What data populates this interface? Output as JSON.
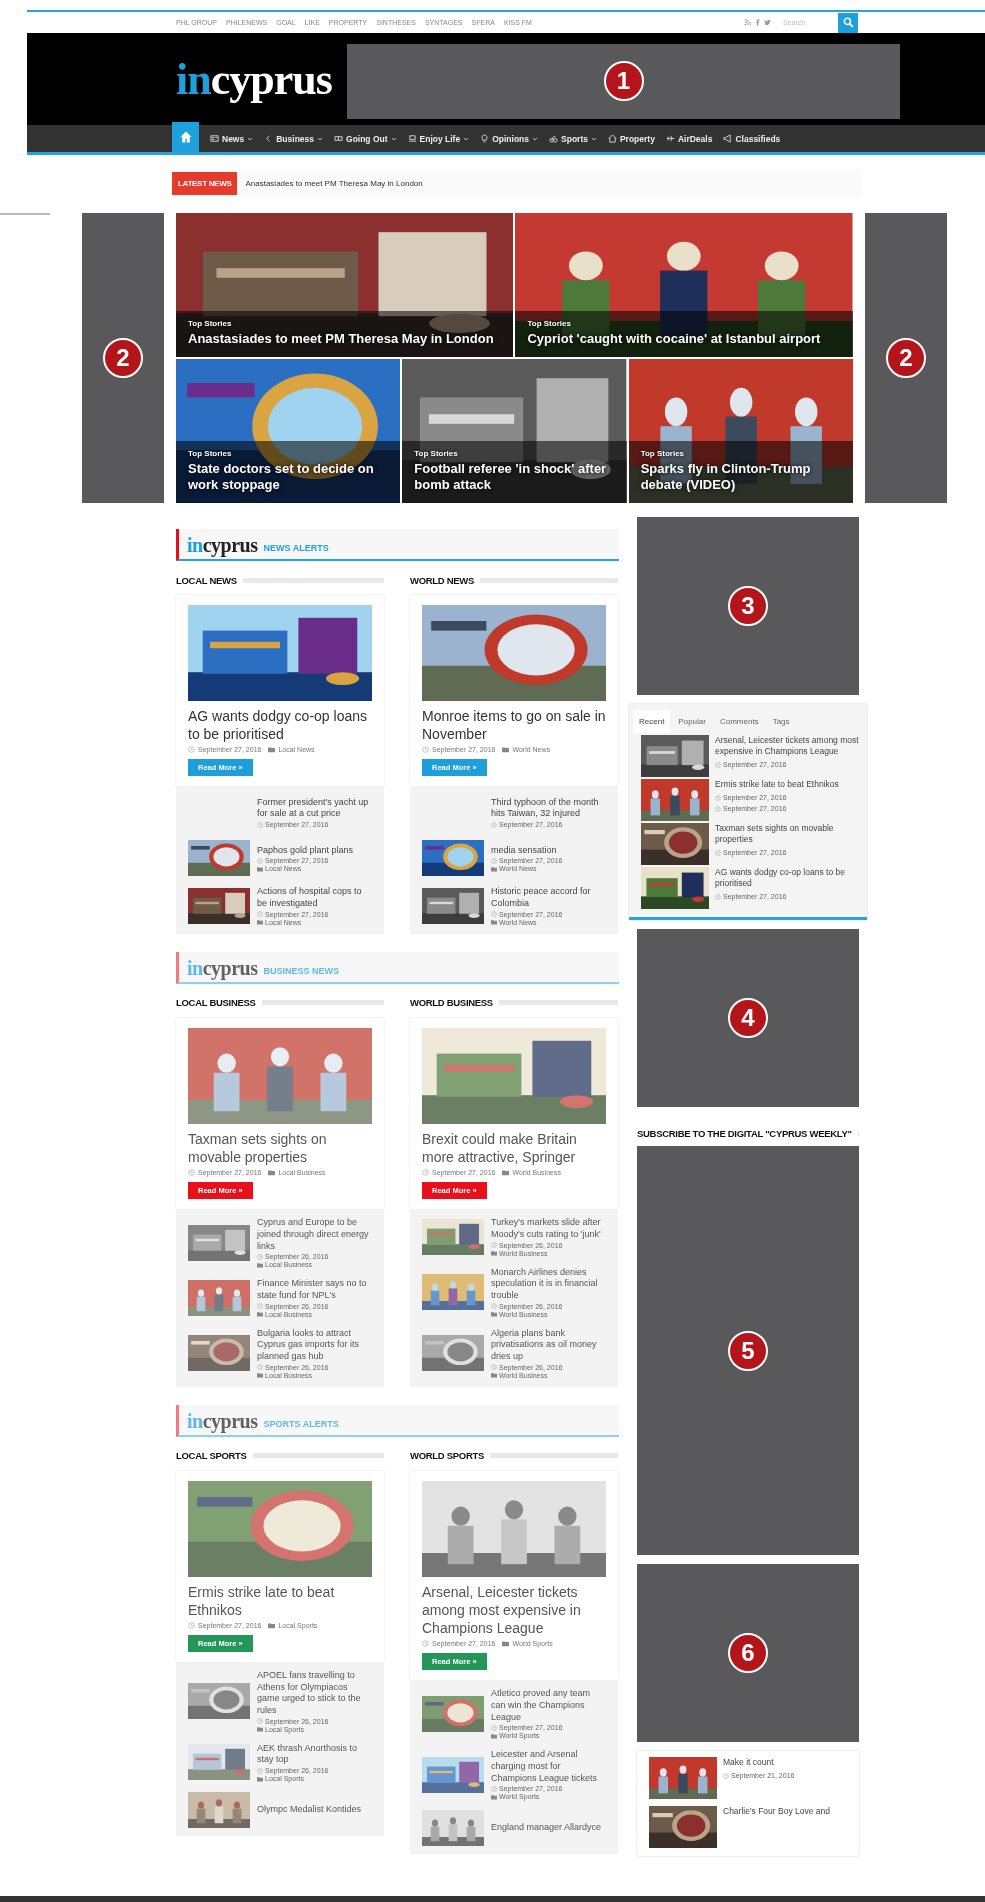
{
  "top_bar": {
    "links": [
      "PHL GROUP",
      "PHILENEWS",
      "GOAL",
      "LIKE",
      "PROPERTY",
      "SINTHESES",
      "SYNTAGES",
      "SFERA",
      "KISS FM"
    ],
    "search": {
      "placeholder": "Search"
    }
  },
  "header": {
    "logo": {
      "accent": "in",
      "rest": "cyprus"
    },
    "ad": {
      "number": "1"
    }
  },
  "nav": {
    "items": [
      {
        "kind": "home",
        "selected": true
      },
      {
        "kind": "menu",
        "label": "News",
        "dropdown": true,
        "selected": false
      },
      {
        "kind": "menu",
        "label": "Business",
        "dropdown": true,
        "selected": false
      },
      {
        "kind": "menu",
        "label": "Going Out",
        "dropdown": true,
        "selected": false
      },
      {
        "kind": "menu",
        "label": "Enjoy Life",
        "dropdown": true,
        "selected": false
      },
      {
        "kind": "menu",
        "label": "Opinions",
        "dropdown": true,
        "selected": false
      },
      {
        "kind": "menu",
        "label": "Sports",
        "dropdown": true,
        "selected": false
      },
      {
        "kind": "menu",
        "label": "Property",
        "dropdown": false,
        "selected": false
      },
      {
        "kind": "menu",
        "label": "AirDeals",
        "dropdown": false,
        "selected": false
      },
      {
        "kind": "menu",
        "label": "Classifieds",
        "dropdown": false,
        "selected": false
      }
    ]
  },
  "latest_news": {
    "label": "LATEST NEWS",
    "headline": "Anastasiades to meet PM Theresa May in London"
  },
  "side_ads": [
    {
      "number": "2"
    },
    {
      "number": "2"
    }
  ],
  "hero": {
    "tiles": [
      {
        "category": "Top Stories",
        "title": "Anastasiades to meet PM Theresa May in London"
      },
      {
        "category": "Top Stories",
        "title": "Cypriot 'caught with cocaine' at Istanbul airport"
      },
      {
        "category": "Top Stories",
        "title": "State doctors set to decide on work stoppage"
      },
      {
        "category": "Top Stories",
        "title": "Football referee 'in shock' after bomb attack"
      },
      {
        "category": "Top Stories",
        "title": "Sparks fly in Clinton-Trump debate (VIDEO)"
      }
    ]
  },
  "sections": [
    {
      "brand": {
        "accent": "in",
        "rest": "cyprus"
      },
      "label": "NEWS ALERTS",
      "dimmed": false,
      "color": "#1e9fdc",
      "columns": [
        {
          "title": "LOCAL NEWS",
          "featured": {
            "title": "AG wants dodgy co-op loans to be prioritised",
            "date": "September 27, 2016",
            "category": "Local News",
            "button": "Read More »"
          },
          "items": [
            {
              "title": "Former president's yacht up for sale at a cut price",
              "date": "September 27, 2016",
              "image": false
            },
            {
              "title": "Paphos gold plant plans",
              "date": "September 27, 2016",
              "category": "Local News",
              "image": true
            },
            {
              "title": "Actions of hospital cops to be investigated",
              "date": "September 27, 2016",
              "category": "Local News",
              "image": true
            }
          ]
        },
        {
          "title": "WORLD NEWS",
          "featured": {
            "title": "Monroe items to go on sale in November",
            "date": "September 27, 2016",
            "category": "World News",
            "button": "Read More »"
          },
          "items": [
            {
              "title": "Third typhoon of the month hits Taiwan, 32 injured",
              "date": "September 27, 2016",
              "image": false
            },
            {
              "title": "media sensation",
              "date": "September 27, 2016",
              "category": "World News",
              "image": true
            },
            {
              "title": "Historic peace accord for Colombia",
              "date": "September 27, 2016",
              "category": "World News",
              "image": true
            }
          ]
        }
      ]
    },
    {
      "brand": {
        "accent": "in",
        "rest": "cyprus"
      },
      "label": "BUSINESS NEWS",
      "dimmed": true,
      "color": "#e8101a",
      "columns": [
        {
          "title": "LOCAL BUSINESS",
          "featured": {
            "title": "Taxman sets sights on movable properties",
            "date": "September 27, 2016",
            "category": "Local Business",
            "button": "Read More »"
          },
          "items": [
            {
              "title": "Cyprus and Europe to be joined through direct energy links",
              "date": "September 26, 2016",
              "category": "Local Business",
              "image": true
            },
            {
              "title": "Finance Minister says no to state fund for NPL's",
              "date": "September 26, 2016",
              "category": "Local Business",
              "image": true
            },
            {
              "title": "Bulgaria looks to attract Cyprus gas imports for its planned gas hub",
              "date": "September 26, 2016",
              "category": "Local Business",
              "image": true
            }
          ]
        },
        {
          "title": "WORLD BUSINESS",
          "featured": {
            "title": "Brexit could make Britain more attractive, Springer",
            "date": "September 27, 2016",
            "category": "World Business",
            "button": "Read More »"
          },
          "items": [
            {
              "title": "Turkey's markets slide after Moody's cuts rating to 'junk'",
              "date": "September 26, 2016",
              "category": "World Business",
              "image": true
            },
            {
              "title": "Monarch Airlines denies speculation it is in financial trouble",
              "date": "September 26, 2016",
              "category": "World Business",
              "image": true
            },
            {
              "title": "Algeria plans bank privatisations as oil money dries up",
              "date": "September 26, 2016",
              "category": "World Business",
              "image": true
            }
          ]
        }
      ]
    },
    {
      "brand": {
        "accent": "in",
        "rest": "cyprus"
      },
      "label": "SPORTS ALERTS",
      "dimmed": true,
      "color": "#24965a",
      "columns": [
        {
          "title": "LOCAL SPORTS",
          "featured": {
            "title": "Ermis strike late to beat Ethnikos",
            "date": "September 27, 2016",
            "category": "Local Sports",
            "button": "Read More »"
          },
          "items": [
            {
              "title": "APOEL fans travelling to Athens for Olympiacos game urged to stick to the rules",
              "date": "September 26, 2016",
              "category": "Local Sports",
              "image": true
            },
            {
              "title": "AEK thrash Anorthosis to stay top",
              "date": "September 26, 2016",
              "category": "Local Sports",
              "image": true
            },
            {
              "title": "Olympc Medalist Kontides",
              "image": true
            }
          ]
        },
        {
          "title": "WORLD SPORTS",
          "featured": {
            "title": "Arsenal, Leicester tickets among most expensive in Champions League",
            "date": "September 27, 2016",
            "category": "World Sports",
            "button": "Read More »"
          },
          "items": [
            {
              "title": "Atletico proved any team can win the Champions League",
              "date": "September 27, 2016",
              "category": "World Sports",
              "image": true
            },
            {
              "title": "Leicester and Arsenal charging most for Champions League tickets",
              "date": "September 27, 2016",
              "category": "World Sports",
              "image": true
            },
            {
              "title": "England manager Allardyce",
              "image": true
            }
          ]
        }
      ]
    }
  ],
  "sidebar": {
    "blocks": [
      {
        "kind": "ad",
        "number": "3"
      },
      {
        "kind": "tabs",
        "tabs": [
          {
            "label": "Recent",
            "selected": true
          },
          {
            "label": "Popular",
            "selected": false
          },
          {
            "label": "Comments",
            "selected": false
          },
          {
            "label": "Tags",
            "selected": false
          }
        ],
        "items": [
          {
            "title": "Arsenal, Leicester tickets among most expensive in Champions League",
            "dates": [
              "September 27, 2016"
            ]
          },
          {
            "title": "Ermis strike late to beat Ethnikos",
            "dates": [
              "September 27, 2016",
              "September 27, 2016"
            ]
          },
          {
            "title": "Taxman sets sights on movable properties",
            "dates": [
              "September 27, 2016"
            ]
          },
          {
            "title": "AG wants dodgy co-op loans to be prioritised",
            "dates": [
              "September 27, 2016"
            ]
          }
        ]
      },
      {
        "kind": "ad",
        "number": "4"
      },
      {
        "kind": "titled_ad",
        "title": "SUBSCRIBE TO THE DIGITAL \"CYPRUS WEEKLY\"",
        "number": "5"
      },
      {
        "kind": "ad",
        "number": "6"
      },
      {
        "kind": "list",
        "items": [
          {
            "title": "Make it count",
            "dates": [
              "September 21, 2016"
            ]
          },
          {
            "title": "Charlie's Four Boy Love and"
          }
        ]
      }
    ]
  }
}
